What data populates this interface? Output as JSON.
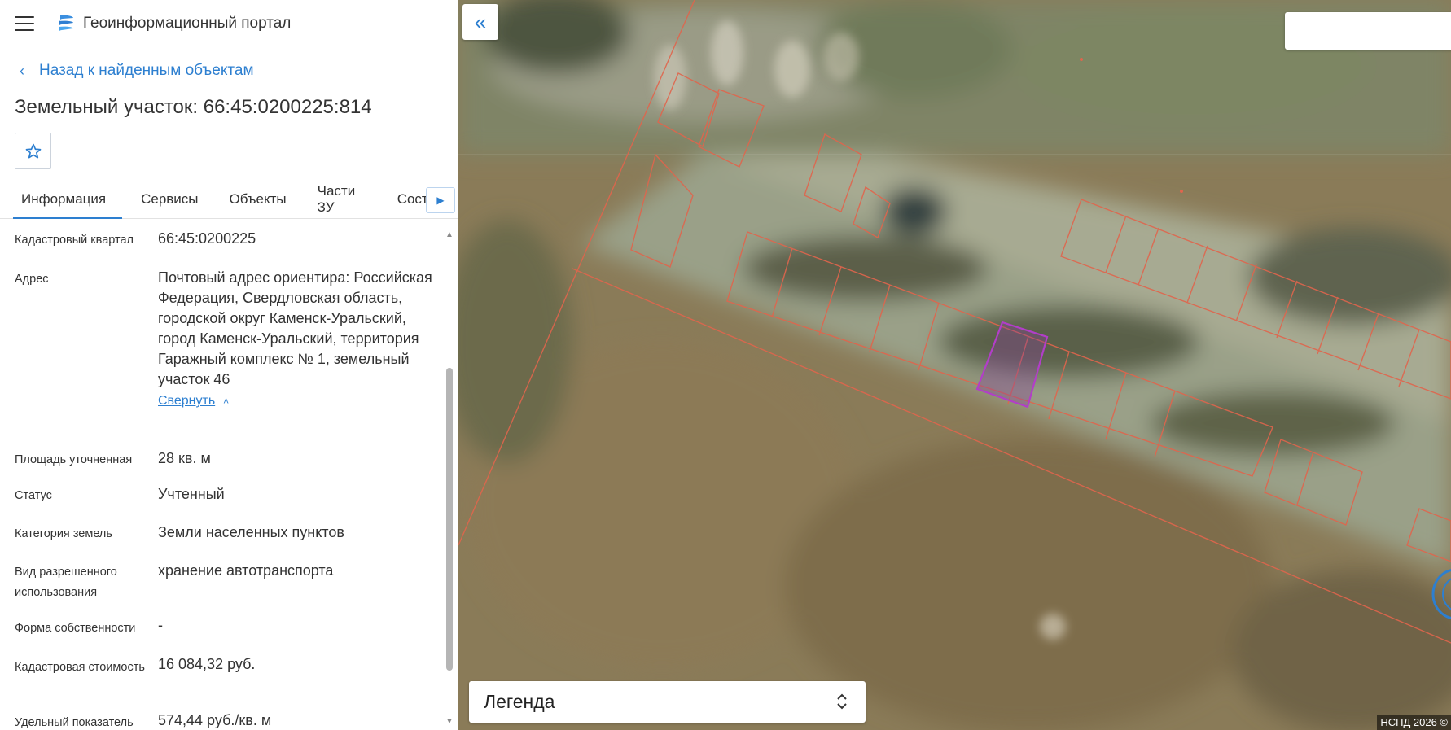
{
  "app": {
    "title": "Геоинформационный портал"
  },
  "nav": {
    "back_label": "Назад к найденным объектам"
  },
  "object": {
    "title": "Земельный участок: 66:45:0200225:814"
  },
  "tabs": [
    {
      "label": "Информация",
      "active": true
    },
    {
      "label": "Сервисы"
    },
    {
      "label": "Объекты"
    },
    {
      "label": "Части ЗУ"
    },
    {
      "label": "Состав"
    }
  ],
  "properties": [
    {
      "label": "Кадастровый квартал",
      "value": "66:45:0200225"
    },
    {
      "label": "Адрес",
      "value": "Почтовый адрес ориентира: Российская Федерация, Свердловская область, городской округ Каменск-Уральский, город Каменск-Уральский, территория Гаражный комплекс № 1, земельный участок 46",
      "link": "Свернуть"
    },
    {
      "label": "Площадь уточненная",
      "value": "28 кв. м"
    },
    {
      "label": "Статус",
      "value": "Учтенный"
    },
    {
      "label": "Категория земель",
      "value": "Земли населенных пунктов"
    },
    {
      "label": "Вид разрешенного использования",
      "value": "хранение автотранспорта"
    },
    {
      "label": "Форма собственности",
      "value": "-"
    },
    {
      "label": "Кадастровая стоимость",
      "value": "16 084,32 руб."
    },
    {
      "label": "Удельный показатель",
      "value": "574,44 руб./кв. м"
    }
  ],
  "map": {
    "legend_label": "Легенда",
    "search_placeholder": "",
    "copyright": "НСПД 2026 ©",
    "parcel_color": "#e0654d",
    "selected_color": "#b23ec8"
  },
  "icons": {
    "menu": "hamburger-icon",
    "back": "chevron-left-icon",
    "favorite": "star-icon",
    "tabs_next": "caret-right-icon",
    "collapse_panel": "double-chevron-left-icon",
    "legend_toggle": "chevron-up-down-icon",
    "collapse_address": "chevron-up-icon"
  },
  "colors": {
    "accent": "#2d7fd0"
  }
}
